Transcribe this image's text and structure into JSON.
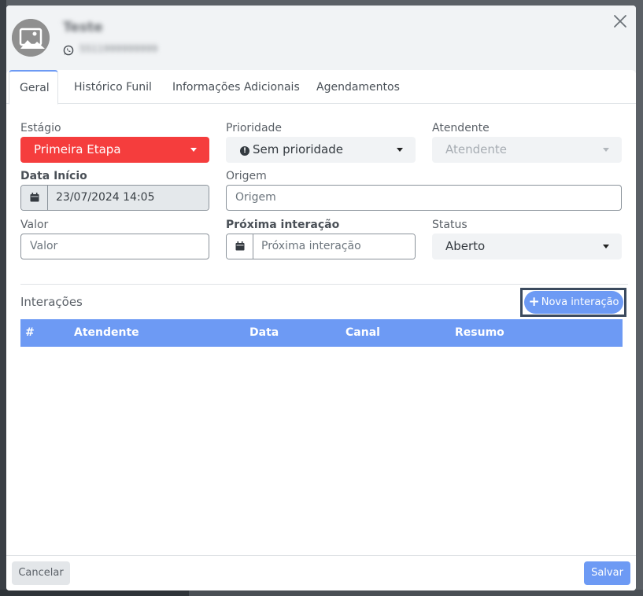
{
  "contact": {
    "name": "Teste",
    "phone": "5511999999999",
    "close_icon": "close-icon",
    "whatsapp_icon": "whatsapp-icon"
  },
  "tabs": [
    {
      "label": "Geral",
      "active": true
    },
    {
      "label": "Histórico Funil",
      "active": false
    },
    {
      "label": "Informações Adicionais",
      "active": false
    },
    {
      "label": "Agendamentos",
      "active": false
    }
  ],
  "form": {
    "estagio": {
      "label": "Estágio",
      "value": "Primeira Etapa"
    },
    "prioridade": {
      "label": "Prioridade",
      "value": "Sem prioridade"
    },
    "atendente": {
      "label": "Atendente",
      "value": "Atendente"
    },
    "data_inicio": {
      "label": "Data Início",
      "value": "23/07/2024 14:05"
    },
    "origem": {
      "label": "Origem",
      "placeholder": "Origem"
    },
    "valor": {
      "label": "Valor",
      "placeholder": "Valor"
    },
    "proxima_interacao": {
      "label": "Próxima interação",
      "placeholder": "Próxima interação"
    },
    "status": {
      "label": "Status",
      "value": "Aberto"
    }
  },
  "interactions": {
    "title": "Interações",
    "new_button": "Nova interação",
    "columns": [
      "#",
      "Atendente",
      "Data",
      "Canal",
      "Resumo"
    ],
    "rows": []
  },
  "footer": {
    "cancel": "Cancelar",
    "save": "Salvar"
  },
  "colors": {
    "accent": "#6d9af4",
    "stage": "#f53d3d"
  }
}
